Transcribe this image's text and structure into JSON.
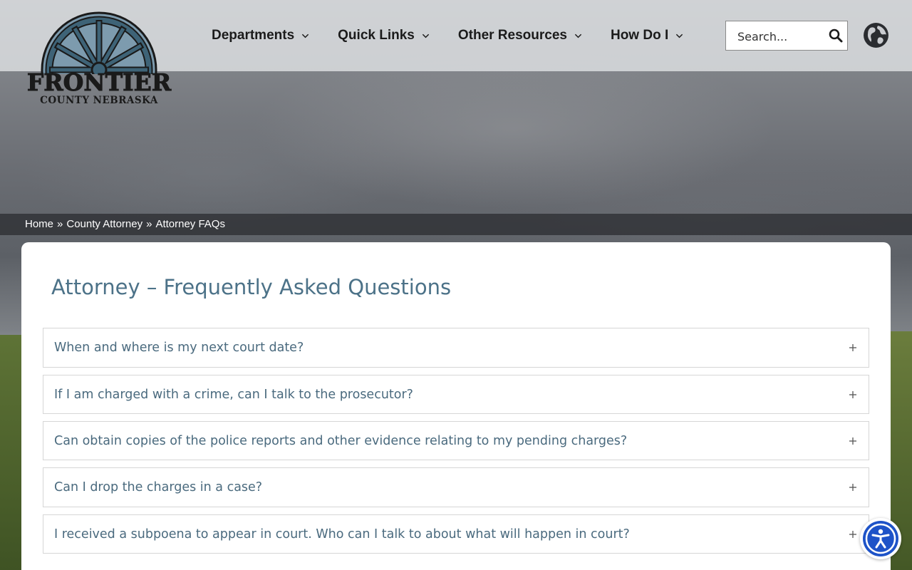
{
  "logo": {
    "line1": "FRONTIER",
    "line2": "COUNTY NEBRASKA",
    "icon": "wagon-wheel-icon"
  },
  "nav": {
    "items": [
      {
        "label": "Departments",
        "icon": "chevron-down-icon"
      },
      {
        "label": "Quick Links",
        "icon": "chevron-down-icon"
      },
      {
        "label": "Other Resources",
        "icon": "chevron-down-icon"
      },
      {
        "label": "How Do I",
        "icon": "chevron-down-icon"
      }
    ]
  },
  "search": {
    "placeholder": "Search...",
    "icon": "search-icon"
  },
  "language": {
    "icon": "globe-icon"
  },
  "breadcrumb": {
    "items": [
      "Home",
      "County Attorney",
      "Attorney FAQs"
    ],
    "separator": "»"
  },
  "page": {
    "title": "Attorney – Frequently Asked Questions"
  },
  "faqs": [
    {
      "question": "When and where is my next court date?"
    },
    {
      "question": "If I am charged with a crime, can I talk to the prosecutor?"
    },
    {
      "question": "Can obtain copies of the police reports and other evidence relating to my pending charges?"
    },
    {
      "question": "Can I drop the charges in a case?"
    },
    {
      "question": "I received a subpoena to appear in court. Who can I talk to about what will happen in court?"
    }
  ],
  "accessibility": {
    "icon": "accessibility-icon"
  },
  "colors": {
    "title": "#4c7288",
    "question": "#4a6a7e",
    "accessibility": "#1e53c8"
  }
}
